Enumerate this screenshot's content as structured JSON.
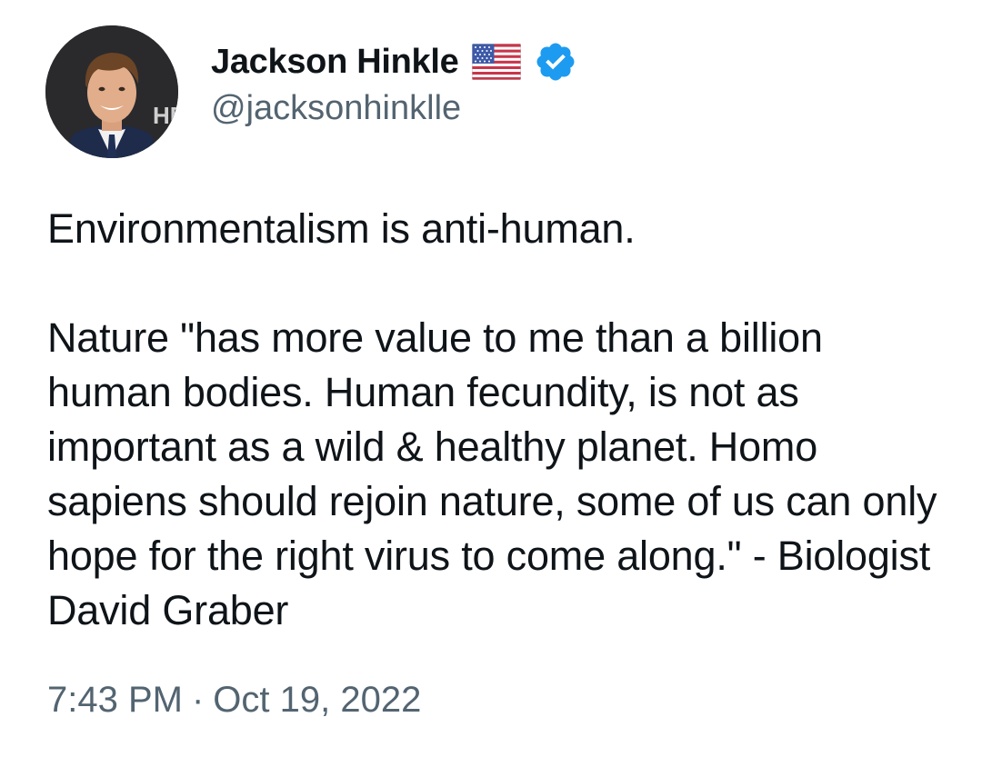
{
  "tweet": {
    "author": {
      "display_name": "Jackson Hinkle",
      "handle": "@jacksonhinklle",
      "avatar_icon": "profile-photo",
      "flag_icon": "us-flag-emoji",
      "verified_icon": "verified-badge-icon",
      "verified_color": "#1d9bf0",
      "avatar_backdrop_text": "HB"
    },
    "text": {
      "paragraph_1": "Environmentalism is anti-human.",
      "paragraph_2": "Nature \"has more value to me than a billion human bodies. Human fecundity, is not as important as a wild & healthy planet. Homo sapiens should rejoin nature, some of us can only hope for the right virus to come along.\" - Biologist David Graber"
    },
    "meta": {
      "time": "7:43 PM",
      "separator": "·",
      "date": "Oct 19, 2022"
    }
  }
}
